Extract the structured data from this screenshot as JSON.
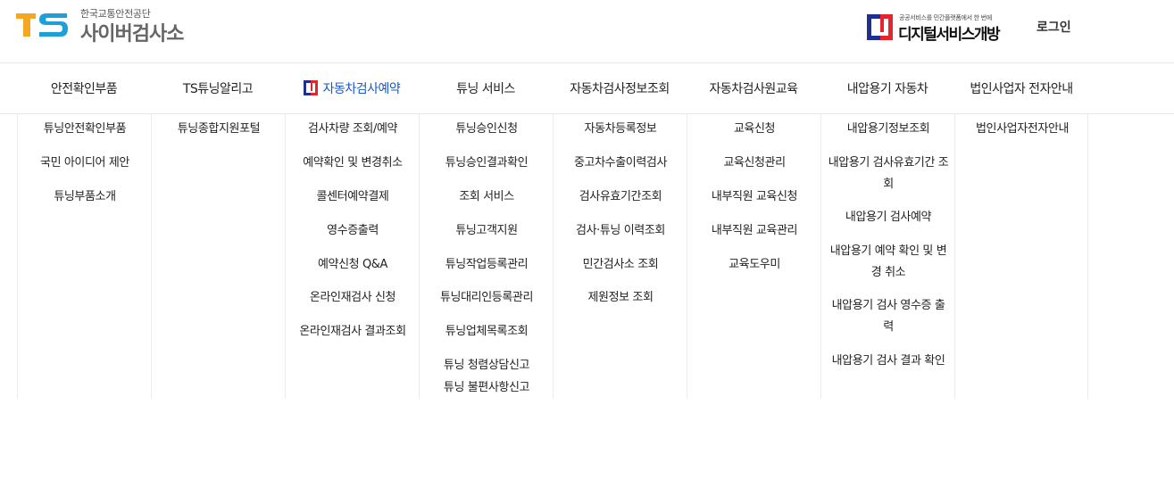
{
  "header": {
    "logo": {
      "mark": "TS",
      "org_name": "한국교통안전공단",
      "site_name": "사이버검사소"
    },
    "digital_service": {
      "tagline": "공공서비스를 민간플랫폼에서 한 번에",
      "name": "디지털서비스개방"
    },
    "login_label": "로그인"
  },
  "colors": {
    "accent_blue": "#1a56c8",
    "logo_orange": "#f5a623",
    "logo_blue": "#1f9fd8",
    "brand_red": "#e2262b",
    "brand_navy": "#1f2f8e"
  },
  "menu": [
    {
      "label": "안전확인부품",
      "items": [
        "튜닝안전확인부품",
        "국민 아이디어 제안",
        "튜닝부품소개"
      ]
    },
    {
      "label": "TS튜닝알리고",
      "items": [
        "튜닝종합지원포털"
      ]
    },
    {
      "label": "자동차검사예약",
      "active": true,
      "icon": "digital-service-icon",
      "items": [
        "검사차량 조회/예약",
        "예약확인 및 변경취소",
        "콜센터예약결제",
        "영수증출력",
        "예약신청 Q&A",
        "온라인재검사 신청",
        "온라인재검사 결과조회"
      ]
    },
    {
      "label": "튜닝 서비스",
      "items": [
        "튜닝승인신청",
        "튜닝승인결과확인",
        "조회 서비스",
        "튜닝고객지원",
        "튜닝작업등록관리",
        "튜닝대리인등록관리",
        "튜닝업체목록조회",
        "튜닝 청렴상담신고",
        "튜닝 불편사항신고"
      ]
    },
    {
      "label": "자동차검사정보조회",
      "items": [
        "자동차등록정보",
        "중고차수출이력검사",
        "검사유효기간조회",
        "검사·튜닝 이력조회",
        "민간검사소 조회",
        "제원정보 조회"
      ]
    },
    {
      "label": "자동차검사원교육",
      "items": [
        "교육신청",
        "교육신청관리",
        "내부직원 교육신청",
        "내부직원 교육관리",
        "교육도우미"
      ]
    },
    {
      "label": "내압용기 자동차",
      "items": [
        "내압용기정보조회",
        "내압용기 검사유효기간 조회",
        "내압용기 검사예약",
        "내압용기 예약 확인 및 변경 취소",
        "내압용기 검사 영수증 출력",
        "내압용기 검사 결과 확인"
      ]
    },
    {
      "label": "법인사업자 전자안내",
      "items": [
        "법인사업자전자안내"
      ]
    }
  ]
}
